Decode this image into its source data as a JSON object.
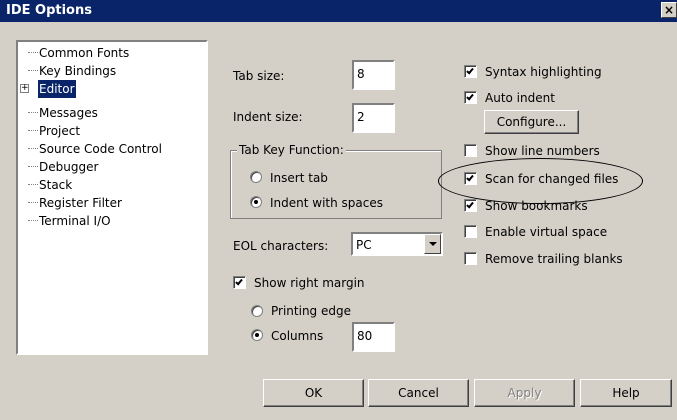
{
  "window": {
    "title": "IDE Options",
    "close_glyph": "×"
  },
  "tree": {
    "items": [
      {
        "label": "Common Fonts"
      },
      {
        "label": "Key Bindings"
      },
      {
        "label": "Editor",
        "selected": true,
        "expandable": true
      },
      {
        "label": "Messages"
      },
      {
        "label": "Project"
      },
      {
        "label": "Source Code Control"
      },
      {
        "label": "Debugger"
      },
      {
        "label": "Stack"
      },
      {
        "label": "Register Filter"
      },
      {
        "label": "Terminal I/O"
      }
    ],
    "expand_glyph": "+"
  },
  "editor": {
    "tab_size_label": "Tab size:",
    "tab_size_value": "8",
    "indent_size_label": "Indent size:",
    "indent_size_value": "2",
    "tab_key_group_label": "Tab Key Function:",
    "insert_tab_label": "Insert tab",
    "indent_spaces_label": "Indent with spaces",
    "tab_key_selected": "indent_with_spaces",
    "eol_label": "EOL characters:",
    "eol_value": "PC",
    "show_right_margin_label": "Show right margin",
    "show_right_margin_checked": true,
    "printing_edge_label": "Printing edge",
    "columns_label": "Columns",
    "margin_mode_selected": "columns",
    "columns_value": "80"
  },
  "checkboxes": [
    {
      "label": "Syntax highlighting",
      "checked": true
    },
    {
      "label": "Auto indent",
      "checked": true
    },
    {
      "label": "Show line numbers",
      "checked": false
    },
    {
      "label": "Scan for changed files",
      "checked": true
    },
    {
      "label": "Show bookmarks",
      "checked": true
    },
    {
      "label": "Enable virtual space",
      "checked": false
    },
    {
      "label": "Remove trailing blanks",
      "checked": false
    }
  ],
  "configure_label": "Configure...",
  "buttons": {
    "ok": "OK",
    "cancel": "Cancel",
    "apply": "Apply",
    "help": "Help"
  },
  "colors": {
    "titlebar": "#0a246a",
    "face": "#d4d0c8",
    "selection": "#0a246a"
  }
}
